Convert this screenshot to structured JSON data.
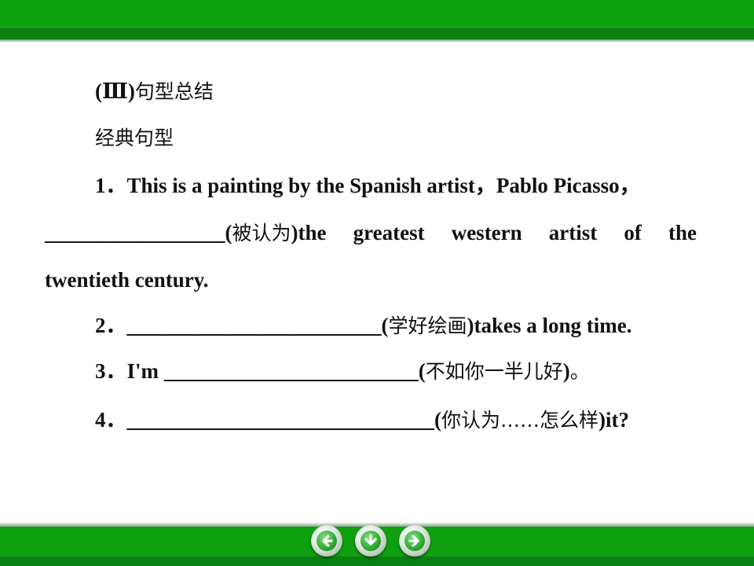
{
  "heading": {
    "prefix": "(Ⅲ)",
    "title": "句型总结"
  },
  "subheading": "经典句型",
  "items": [
    {
      "number": "1．",
      "line1_text": "This is a painting by the Spanish artist，Pablo Picasso，",
      "line2_blank": "_________________",
      "line2_hint_open": "(",
      "line2_hint": "被认为",
      "line2_hint_close": ")",
      "line2_words": [
        "the",
        "greatest",
        "western",
        "artist",
        "of",
        "the"
      ],
      "line3_text": "twentieth century."
    },
    {
      "number": "2．",
      "blank": "________________________",
      "hint_open": "(",
      "hint": "学好绘画",
      "hint_close": ")",
      "tail": "takes a long time."
    },
    {
      "number": "3．",
      "lead": "I'm ",
      "blank": "________________________",
      "hint_open": "(",
      "hint": "不如你一半儿好",
      "hint_close": ")",
      "tail": "。"
    },
    {
      "number": "4．",
      "blank": "_____________________________",
      "hint_open": "(",
      "hint": "你认为……怎么样",
      "hint_close": ")",
      "tail": "it?"
    }
  ],
  "navigation": {
    "back_icon": "arrow-left-icon",
    "down_icon": "arrow-down-icon",
    "forward_icon": "arrow-right-icon"
  },
  "colors": {
    "banner_green": "#0fa00f",
    "banner_dark_green": "#0a7f14"
  }
}
